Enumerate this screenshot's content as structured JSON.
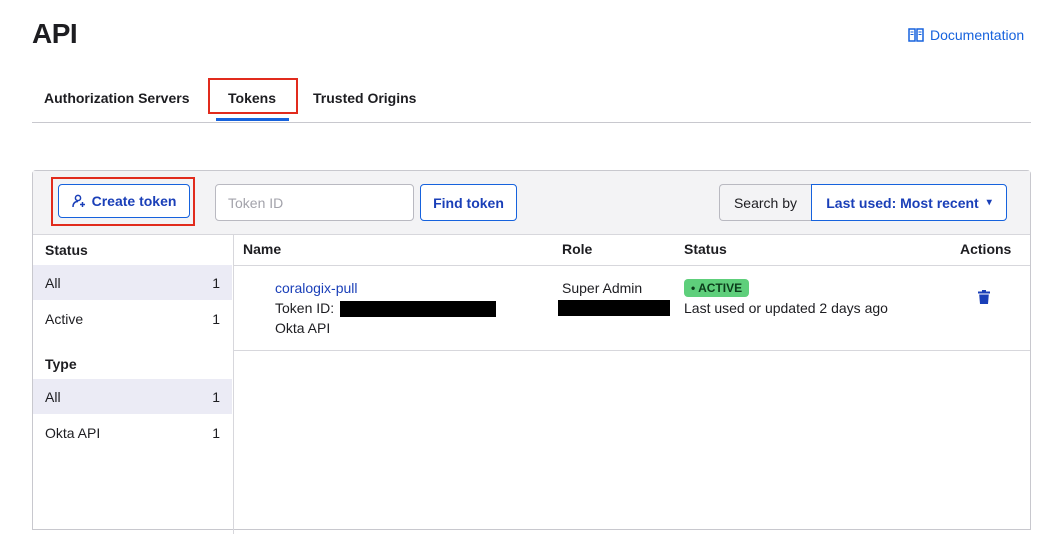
{
  "page": {
    "title": "API"
  },
  "documentation": {
    "label": "Documentation",
    "icon": "book-icon"
  },
  "tabs": [
    {
      "label": "Authorization Servers"
    },
    {
      "label": "Tokens",
      "active": true
    },
    {
      "label": "Trusted Origins"
    }
  ],
  "toolbar": {
    "create_label": "Create token",
    "token_id_placeholder": "Token ID",
    "find_label": "Find token",
    "search_by_label": "Search by",
    "search_by_value": "Last used: Most recent",
    "caret": "▾"
  },
  "sidebar": {
    "status_heading": "Status",
    "status_items": [
      {
        "label": "All",
        "count": "1",
        "selected": true
      },
      {
        "label": "Active",
        "count": "1"
      }
    ],
    "type_heading": "Type",
    "type_items": [
      {
        "label": "All",
        "count": "1",
        "selected": true
      },
      {
        "label": "Okta API",
        "count": "1"
      }
    ]
  },
  "table": {
    "columns": [
      "Name",
      "Role",
      "Status",
      "Actions"
    ],
    "rows": [
      {
        "name": "coralogix-pull",
        "token_id_label": "Token ID:",
        "type": "Okta API",
        "role": "Super Admin",
        "status_badge": "• ACTIVE",
        "status_detail": "Last used or updated 2 days ago",
        "action_icon": "trash-icon"
      }
    ]
  },
  "colors": {
    "accent": "#1662dd",
    "highlight_box": "#e12b1d",
    "active_badge": "#5ecf7b"
  }
}
